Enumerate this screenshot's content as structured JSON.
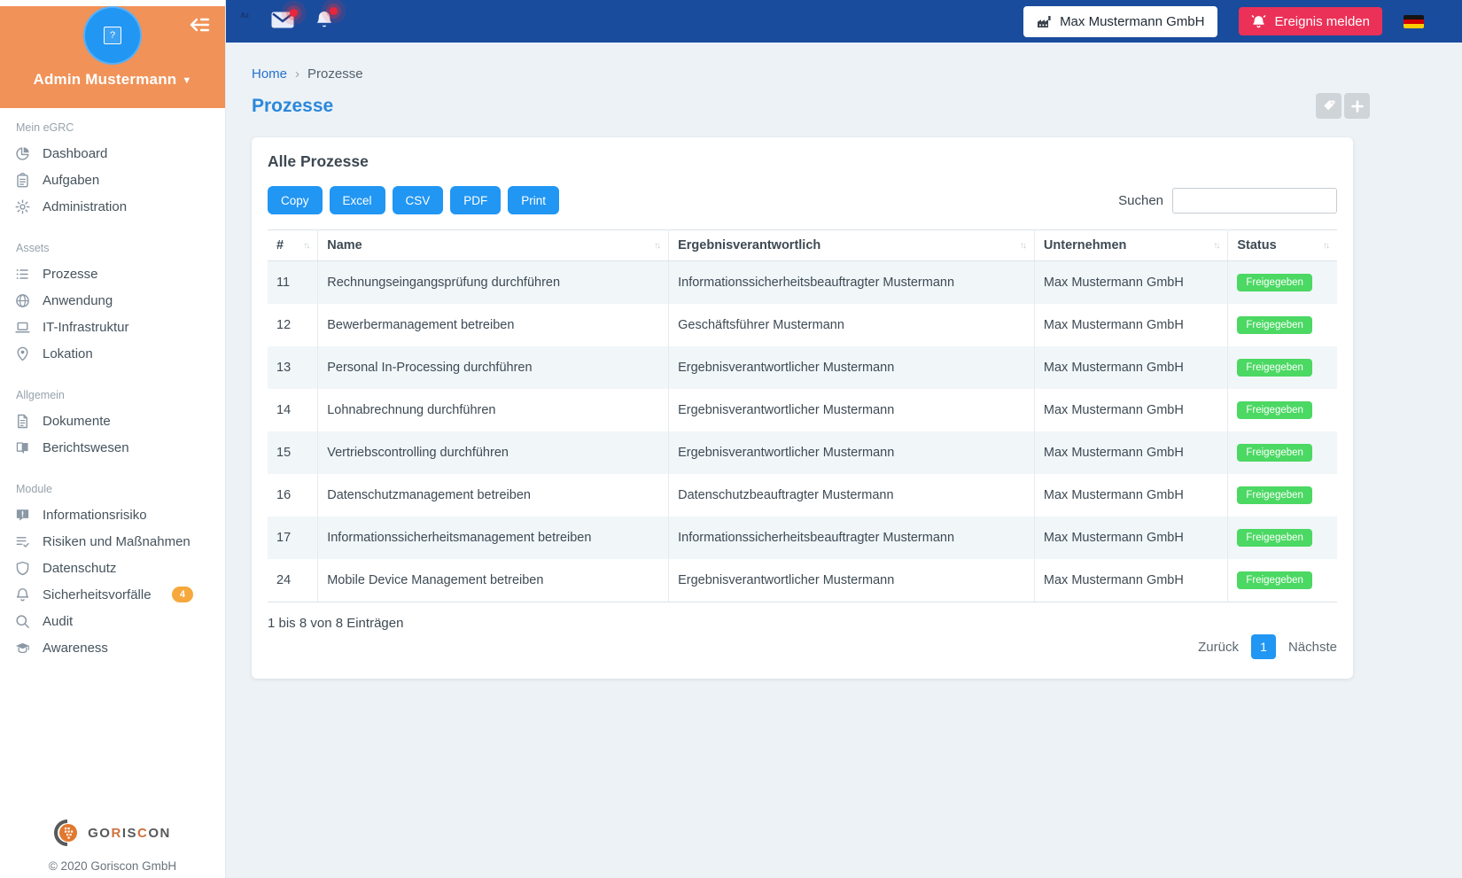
{
  "colors": {
    "navbar_blue": "#1A4C9E",
    "sidebar_header_orange": "#F19258",
    "primary_blue": "#2196F3",
    "title_blue": "#2B87DB",
    "danger_red": "#EB3158",
    "status_green": "#4BD863",
    "badge_orange": "#F6A83C"
  },
  "sidebar": {
    "user": {
      "name": "Admin Mustermann"
    },
    "sections": [
      {
        "title": "Mein eGRC",
        "items": [
          {
            "label": "Dashboard",
            "icon": "pie-chart-icon"
          },
          {
            "label": "Aufgaben",
            "icon": "clipboard-icon"
          },
          {
            "label": "Administration",
            "icon": "gear-icon"
          }
        ]
      },
      {
        "title": "Assets",
        "items": [
          {
            "label": "Prozesse",
            "icon": "list-icon"
          },
          {
            "label": "Anwendung",
            "icon": "globe-icon"
          },
          {
            "label": "IT-Infrastruktur",
            "icon": "laptop-icon"
          },
          {
            "label": "Lokation",
            "icon": "map-pin-icon"
          }
        ]
      },
      {
        "title": "Allgemein",
        "items": [
          {
            "label": "Dokumente",
            "icon": "document-icon"
          },
          {
            "label": "Berichtswesen",
            "icon": "book-icon"
          }
        ]
      },
      {
        "title": "Module",
        "items": [
          {
            "label": "Informationsrisiko",
            "icon": "comment-alert-icon"
          },
          {
            "label": "Risiken und Maßnahmen",
            "icon": "list-check-icon"
          },
          {
            "label": "Datenschutz",
            "icon": "shield-icon"
          },
          {
            "label": "Sicherheitsvorfälle",
            "icon": "bell-icon",
            "badge": "4"
          },
          {
            "label": "Audit",
            "icon": "search-icon"
          },
          {
            "label": "Awareness",
            "icon": "graduation-cap-icon"
          }
        ]
      }
    ],
    "logo_segments": [
      {
        "text": "GO",
        "tone": "dark"
      },
      {
        "text": "R",
        "tone": "orange"
      },
      {
        "text": "IS",
        "tone": "dark"
      },
      {
        "text": "C",
        "tone": "orange"
      },
      {
        "text": "ON",
        "tone": "dark"
      }
    ],
    "copyright": "© 2020 Goriscon GmbH"
  },
  "navbar": {
    "left_icons": [
      "dictionary-icon",
      "mail-icon",
      "notifications-bell-icon"
    ],
    "company_button": "Max Mustermann GmbH",
    "report_button": "Ereignis melden",
    "flag": "german-flag"
  },
  "breadcrumb": {
    "home": "Home",
    "current": "Prozesse"
  },
  "page": {
    "title": "Prozesse",
    "header_actions": [
      "tags-icon",
      "plus-icon"
    ]
  },
  "card": {
    "title": "Alle Prozesse",
    "export_buttons": [
      "Copy",
      "Excel",
      "CSV",
      "PDF",
      "Print"
    ],
    "search_label": "Suchen",
    "search_value": "",
    "table": {
      "columns": [
        "#",
        "Name",
        "Ergebnisverantwortlich",
        "Unternehmen",
        "Status"
      ],
      "rows": [
        {
          "id": "11",
          "name": "Rechnungseingangsprüfung durchführen",
          "responsible": "Informationssicherheitsbeauftragter Mustermann",
          "company": "Max Mustermann GmbH",
          "status": "Freigegeben"
        },
        {
          "id": "12",
          "name": "Bewerbermanagement betreiben",
          "responsible": "Geschäftsführer Mustermann",
          "company": "Max Mustermann GmbH",
          "status": "Freigegeben"
        },
        {
          "id": "13",
          "name": "Personal In-Processing durchführen",
          "responsible": "Ergebnisverantwortlicher Mustermann",
          "company": "Max Mustermann GmbH",
          "status": "Freigegeben"
        },
        {
          "id": "14",
          "name": "Lohnabrechnung durchführen",
          "responsible": "Ergebnisverantwortlicher Mustermann",
          "company": "Max Mustermann GmbH",
          "status": "Freigegeben"
        },
        {
          "id": "15",
          "name": "Vertriebscontrolling durchführen",
          "responsible": "Ergebnisverantwortlicher Mustermann",
          "company": "Max Mustermann GmbH",
          "status": "Freigegeben"
        },
        {
          "id": "16",
          "name": "Datenschutzmanagement betreiben",
          "responsible": "Datenschutzbeauftragter Mustermann",
          "company": "Max Mustermann GmbH",
          "status": "Freigegeben"
        },
        {
          "id": "17",
          "name": "Informationssicherheitsmanagement betreiben",
          "responsible": "Informationssicherheitsbeauftragter Mustermann",
          "company": "Max Mustermann GmbH",
          "status": "Freigegeben"
        },
        {
          "id": "24",
          "name": "Mobile Device Management betreiben",
          "responsible": "Ergebnisverantwortlicher Mustermann",
          "company": "Max Mustermann GmbH",
          "status": "Freigegeben"
        }
      ]
    },
    "info_text": "1 bis 8 von 8 Einträgen",
    "pagination": {
      "prev": "Zurück",
      "page": "1",
      "next": "Nächste"
    }
  }
}
